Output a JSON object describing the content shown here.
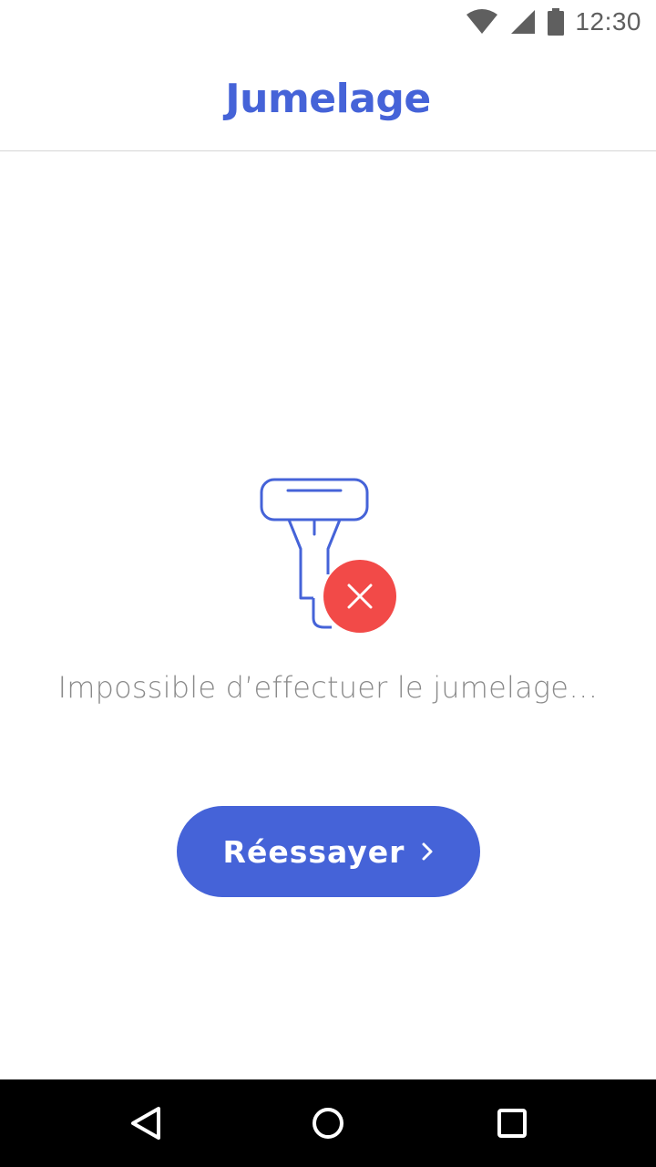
{
  "status_bar": {
    "time": "12:30",
    "icons": [
      "wifi-icon",
      "cell-signal-icon",
      "battery-icon"
    ]
  },
  "app_bar": {
    "title": "Jumelage"
  },
  "illustration": {
    "icon": "device-icon",
    "badge_icon": "error-x-icon",
    "badge_color": "#f24a48",
    "stroke_color": "#4563d8"
  },
  "message": "Impossible d’effectuer le jumelage…",
  "retry_button": {
    "label": "Réessayer",
    "icon": "chevron-right-icon"
  },
  "nav_bar": {
    "buttons": [
      "back-icon",
      "home-icon",
      "recents-icon"
    ]
  },
  "colors": {
    "accent": "#4563d8",
    "error": "#f24a48",
    "text_secondary": "#8a8a8a"
  }
}
